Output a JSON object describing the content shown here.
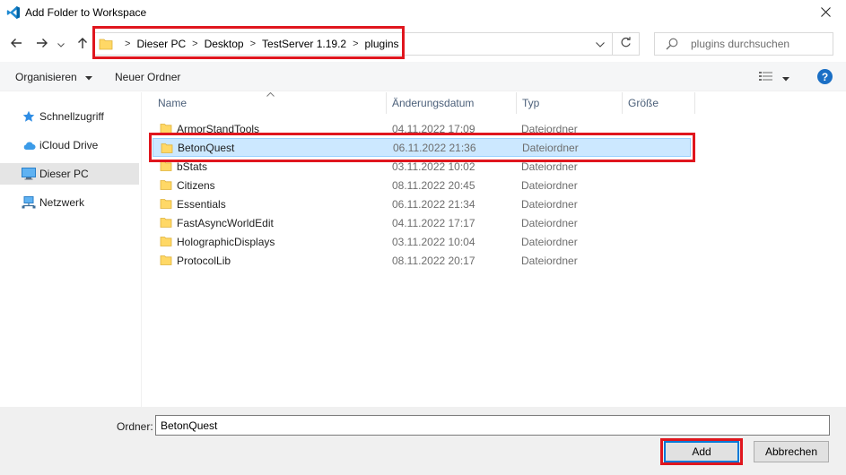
{
  "window": {
    "title": "Add Folder to Workspace",
    "app_icon": "vscode-logo-icon",
    "close_icon": "close-icon"
  },
  "nav": {
    "back_icon": "arrow-left-icon",
    "forward_icon": "arrow-right-icon",
    "recent_icon": "chevron-down-icon",
    "up_icon": "arrow-up-icon"
  },
  "address": {
    "separator": ">",
    "crumbs": [
      "Dieser PC",
      "Desktop",
      "TestServer 1.19.2",
      "plugins"
    ],
    "dropdown_icon": "chevron-down-icon",
    "refresh_icon": "refresh-icon"
  },
  "search": {
    "placeholder": "plugins durchsuchen",
    "icon": "search-icon"
  },
  "toolbar": {
    "organize_label": "Organisieren",
    "new_folder_label": "Neuer Ordner",
    "help_label": "?"
  },
  "sidebar": {
    "items": [
      {
        "label": "Schnellzugriff",
        "icon": "star-icon"
      },
      {
        "label": "iCloud Drive",
        "icon": "cloud-icon"
      },
      {
        "label": "Dieser PC",
        "icon": "computer-icon",
        "active": true
      },
      {
        "label": "Netzwerk",
        "icon": "network-icon"
      }
    ]
  },
  "columns": {
    "name": "Name",
    "date": "Änderungsdatum",
    "type": "Typ",
    "size": "Größe"
  },
  "files": [
    {
      "name": "ArmorStandTools",
      "date": "04.11.2022 17:09",
      "type": "Dateiordner"
    },
    {
      "name": "BetonQuest",
      "date": "06.11.2022 21:36",
      "type": "Dateiordner",
      "selected": true
    },
    {
      "name": "bStats",
      "date": "03.11.2022 10:02",
      "type": "Dateiordner"
    },
    {
      "name": "Citizens",
      "date": "08.11.2022 20:45",
      "type": "Dateiordner"
    },
    {
      "name": "Essentials",
      "date": "06.11.2022 21:34",
      "type": "Dateiordner"
    },
    {
      "name": "FastAsyncWorldEdit",
      "date": "04.11.2022 17:17",
      "type": "Dateiordner"
    },
    {
      "name": "HolographicDisplays",
      "date": "03.11.2022 10:04",
      "type": "Dateiordner"
    },
    {
      "name": "ProtocolLib",
      "date": "08.11.2022 20:17",
      "type": "Dateiordner"
    }
  ],
  "footer": {
    "folder_label": "Ordner:",
    "folder_value": "BetonQuest",
    "add_label": "Add",
    "cancel_label": "Abbrechen"
  },
  "colors": {
    "annotation_red": "#e0161e",
    "selection_bg": "#cce8ff",
    "accent_blue": "#0078d7"
  }
}
